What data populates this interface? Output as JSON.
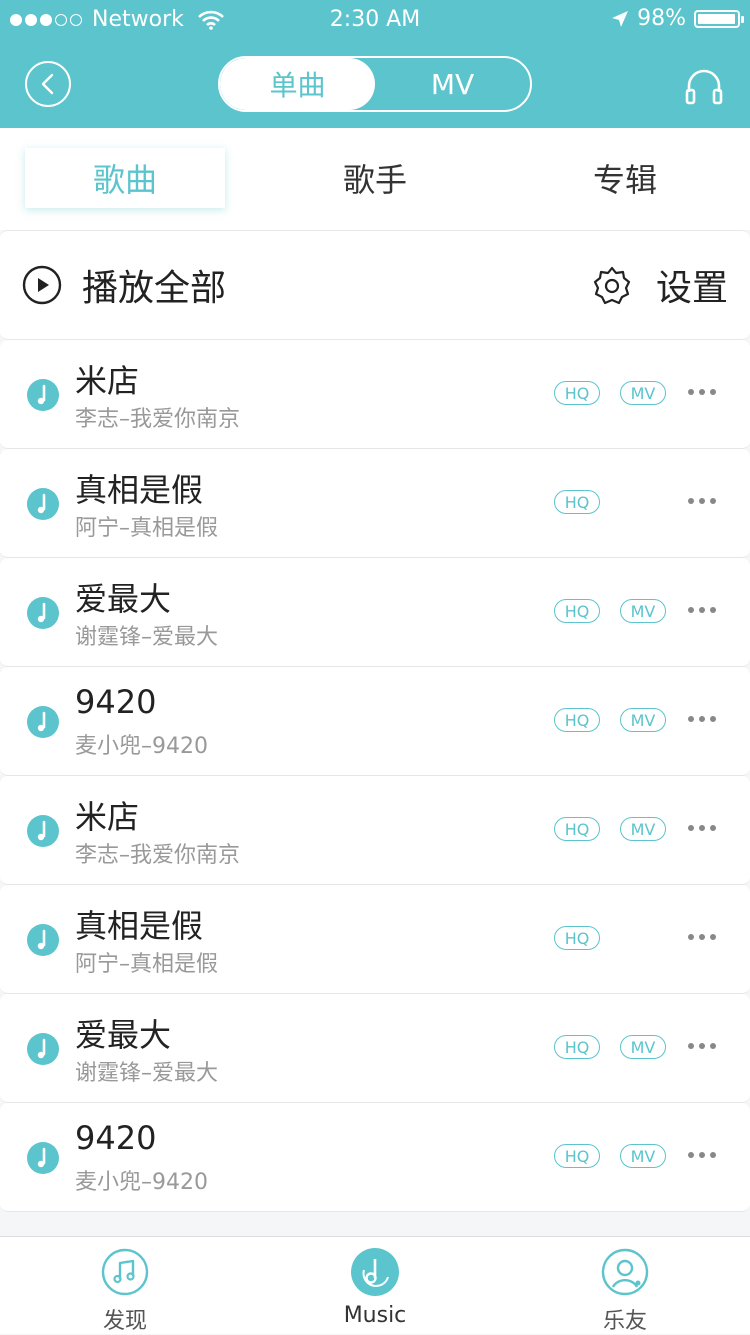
{
  "status_bar": {
    "carrier": "Network",
    "time": "2:30 AM",
    "battery": "98%",
    "battery_level": 0.98
  },
  "header": {
    "segments": [
      {
        "label": "单曲",
        "active": true
      },
      {
        "label": "MV",
        "active": false
      }
    ]
  },
  "tabs": [
    {
      "label": "歌曲",
      "active": true
    },
    {
      "label": "歌手",
      "active": false
    },
    {
      "label": "专辑",
      "active": false
    }
  ],
  "toolbar": {
    "play_all_label": "播放全部",
    "settings_label": "设置"
  },
  "songs": [
    {
      "title": "米店",
      "subtitle": "李志–我爱你南京",
      "hq": "HQ",
      "mv": "MV"
    },
    {
      "title": "真相是假",
      "subtitle": "阿宁–真相是假",
      "hq": "HQ",
      "mv": null
    },
    {
      "title": "爱最大",
      "subtitle": "谢霆锋–爱最大",
      "hq": "HQ",
      "mv": "MV"
    },
    {
      "title": "9420",
      "subtitle": "麦小兜–9420",
      "hq": "HQ",
      "mv": "MV"
    },
    {
      "title": "米店",
      "subtitle": "李志–我爱你南京",
      "hq": "HQ",
      "mv": "MV"
    },
    {
      "title": "真相是假",
      "subtitle": "阿宁–真相是假",
      "hq": "HQ",
      "mv": null
    },
    {
      "title": "爱最大",
      "subtitle": "谢霆锋–爱最大",
      "hq": "HQ",
      "mv": "MV"
    },
    {
      "title": "9420",
      "subtitle": "麦小兜–9420",
      "hq": "HQ",
      "mv": "MV"
    }
  ],
  "tabbar": [
    {
      "label": "发现",
      "icon": "music-note-icon",
      "active": false
    },
    {
      "label": "Music",
      "icon": "music-disc-icon",
      "active": true
    },
    {
      "label": "乐友",
      "icon": "friends-icon",
      "active": false
    }
  ],
  "colors": {
    "accent": "#5bc4cc",
    "text": "#222222",
    "subtext": "#999999"
  }
}
